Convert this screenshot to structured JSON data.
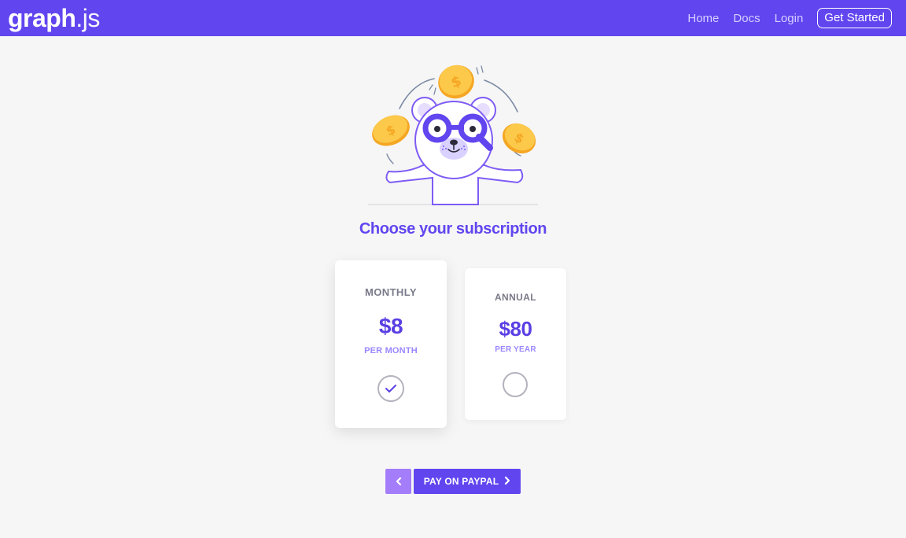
{
  "brand": {
    "logo_bold": "graph",
    "logo_light": "js",
    "accent": "#6145ef"
  },
  "nav": {
    "links": [
      "Home",
      "Docs",
      "Login"
    ],
    "cta": "Get Started"
  },
  "page": {
    "title": "Choose your subscription"
  },
  "plans": [
    {
      "name": "MONTHLY",
      "price": "$8",
      "period": "PER MONTH",
      "selected": true
    },
    {
      "name": "ANNUAL",
      "price": "$80",
      "period": "PER YEAR",
      "selected": false
    }
  ],
  "actions": {
    "back_icon": "chevron-left-icon",
    "pay_label": "PAY ON PAYPAL",
    "pay_icon": "chevron-right-icon"
  },
  "icons": {
    "selected_check": "check-icon"
  }
}
